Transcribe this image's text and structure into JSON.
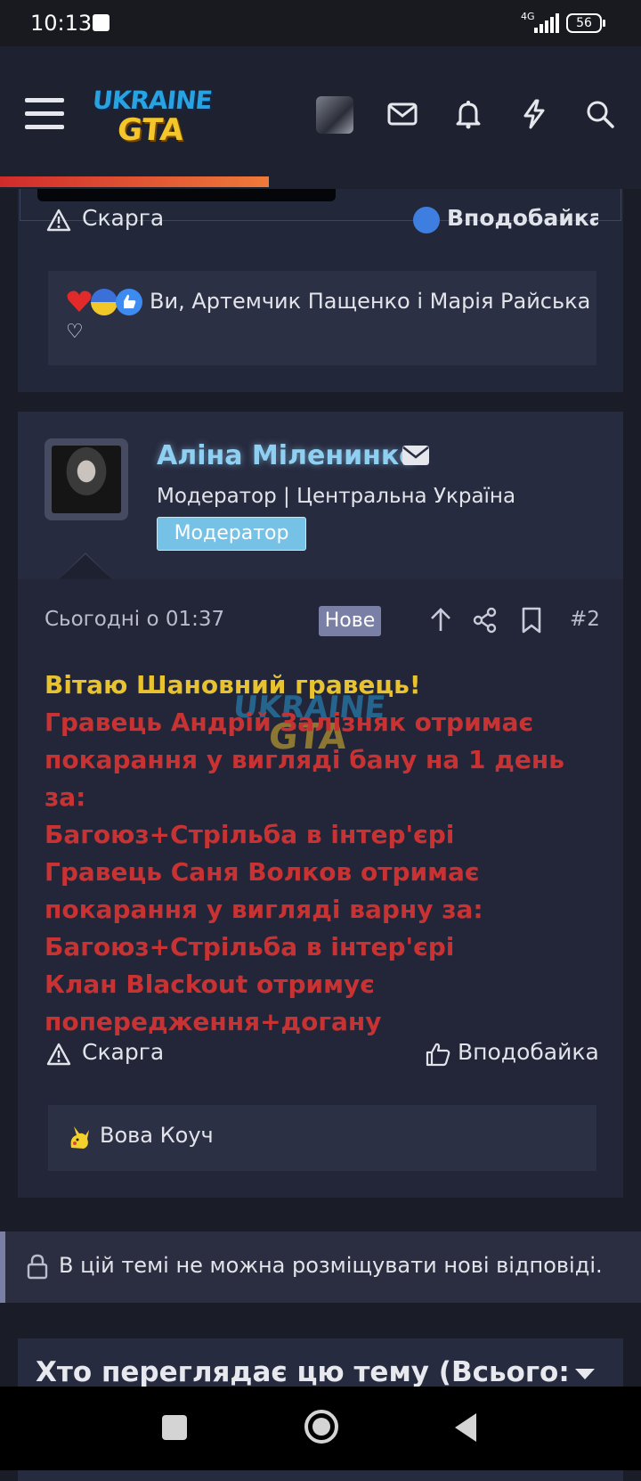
{
  "status_bar": {
    "time": "10:13",
    "network": "4G",
    "battery": "56"
  },
  "header": {
    "logo_top": "UKRAINE",
    "logo_bottom": "GTA",
    "icons": [
      "menu-icon",
      "avatar",
      "envelope-icon",
      "bell-icon",
      "bolt-icon",
      "search-icon"
    ],
    "read_progress": 0.42
  },
  "post1": {
    "report_label": "Скарга",
    "like_label": "Вподобайка",
    "reactions_text": "Ви, Артемчик Пащенко і Марія Райська",
    "reactions_tail": "♡"
  },
  "post2": {
    "username": "Аліна Міленинко",
    "user_title": "Модератор | Центральна Україна",
    "badge": "Модератор",
    "date": "Сьогодні о 01:37",
    "new_badge": "Нове",
    "post_number": "#2",
    "body": {
      "greeting": "Вітаю Шановний гравець!",
      "lines": [
        "Гравець Андрій Залізняк отримає",
        "покарання у вигляді бану на 1 день за:",
        "Багоюз+Стрільба в інтер'єрі",
        "Гравець Саня Волков отримає",
        "покарання у вигляді варну за:",
        "Багоюз+Стрільба в інтер'єрі",
        "Клан Blackout отримує",
        "попередження+догану"
      ]
    },
    "report_label": "Скарга",
    "like_label": "Вподобайка",
    "reactions_text": "Вова Коуч"
  },
  "thread_locked": {
    "message": "В цій темі не можна розміщувати нові відповіді."
  },
  "viewers": {
    "title": "Хто переглядає цю тему (Всього:"
  },
  "colors": {
    "background": "#1a1c27",
    "accent_blue": "#8fd0f2",
    "greeting_yellow": "#e8c32f",
    "body_red": "#c93232",
    "badge_new": "#7a7fa6"
  }
}
